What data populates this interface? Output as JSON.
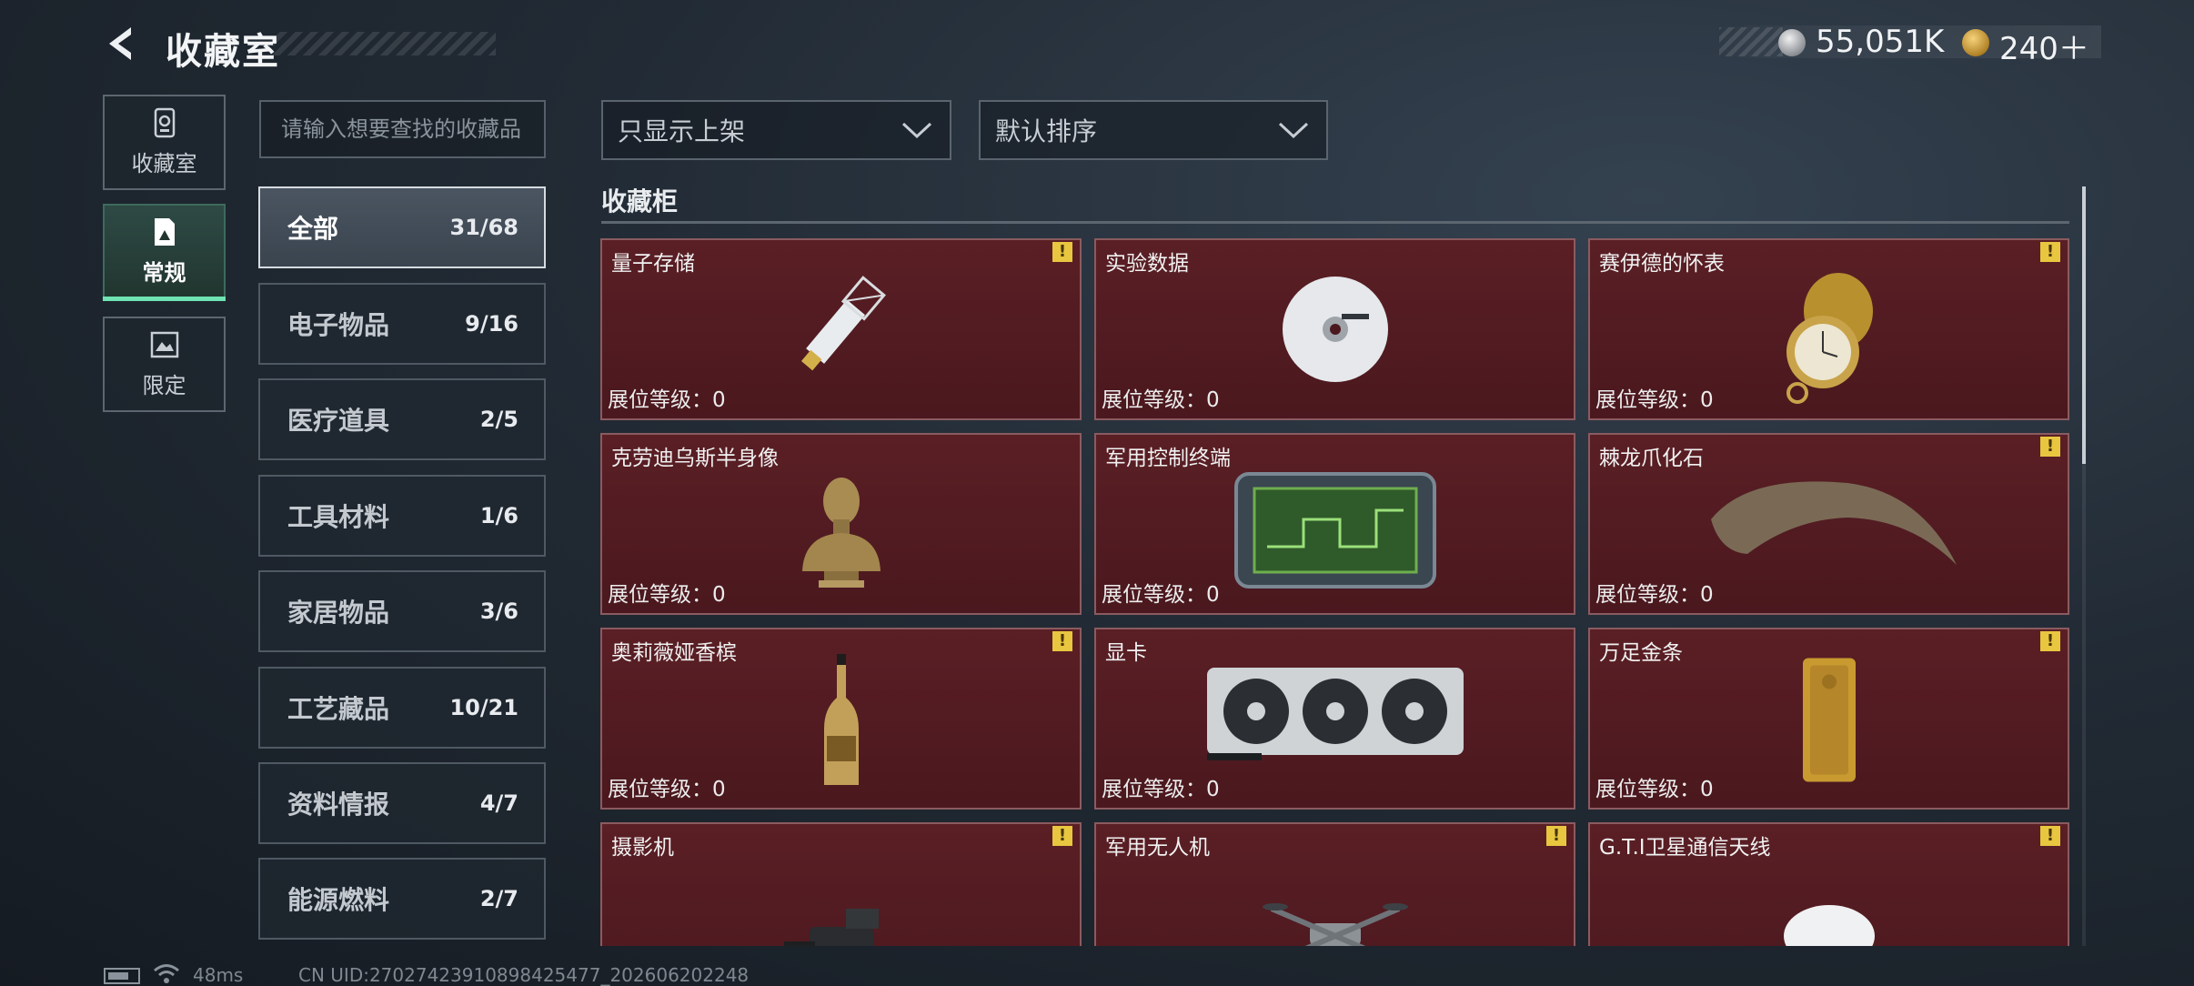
{
  "header": {
    "title": "收藏室",
    "currency1": "55,051K",
    "currency2": "240＋",
    "colors": {
      "currency1_coin": "#8b8f95",
      "currency2_coin": "#b08226"
    }
  },
  "left_nav": [
    {
      "label": "收藏室",
      "icon": "trophy-case-icon"
    },
    {
      "label": "常规",
      "icon": "gallery-icon",
      "selected": true
    },
    {
      "label": "限定",
      "icon": "frame-icon"
    }
  ],
  "search": {
    "placeholder": "请输入想要查找的收藏品"
  },
  "categories": [
    {
      "label": "全部",
      "count": "31/68",
      "active": true
    },
    {
      "label": "电子物品",
      "count": "9/16"
    },
    {
      "label": "医疗道具",
      "count": "2/5"
    },
    {
      "label": "工具材料",
      "count": "1/6"
    },
    {
      "label": "家居物品",
      "count": "3/6"
    },
    {
      "label": "工艺藏品",
      "count": "10/21"
    },
    {
      "label": "资料情报",
      "count": "4/7"
    },
    {
      "label": "能源燃料",
      "count": "2/7"
    }
  ],
  "filters": {
    "filter1": "只显示上架",
    "filter2": "默认排序"
  },
  "section_title": "收藏柜",
  "items": [
    {
      "name": "量子存储",
      "level": "展位等级：0",
      "warn": true,
      "icon": "usb-drive-icon"
    },
    {
      "name": "实验数据",
      "level": "展位等级：0",
      "warn": false,
      "icon": "disc-icon"
    },
    {
      "name": "赛伊德的怀表",
      "level": "展位等级：0",
      "warn": true,
      "icon": "pocket-watch-icon"
    },
    {
      "name": "克劳迪乌斯半身像",
      "level": "展位等级：0",
      "warn": false,
      "icon": "bust-statue-icon"
    },
    {
      "name": "军用控制终端",
      "level": "展位等级：0",
      "warn": false,
      "icon": "tablet-terminal-icon"
    },
    {
      "name": "棘龙爪化石",
      "level": "展位等级：0",
      "warn": true,
      "icon": "claw-fossil-icon"
    },
    {
      "name": "奥莉薇娅香槟",
      "level": "展位等级：0",
      "warn": true,
      "icon": "champagne-bottle-icon"
    },
    {
      "name": "显卡",
      "level": "展位等级：0",
      "warn": false,
      "icon": "graphics-card-icon"
    },
    {
      "name": "万足金条",
      "level": "展位等级：0",
      "warn": true,
      "icon": "gold-bar-icon"
    },
    {
      "name": "摄影机",
      "level": "",
      "warn": true,
      "icon": "video-camera-icon"
    },
    {
      "name": "军用无人机",
      "level": "",
      "warn": true,
      "icon": "drone-icon"
    },
    {
      "name": "G.T.I卫星通信天线",
      "level": "",
      "warn": true,
      "icon": "satellite-dish-icon"
    }
  ],
  "warn_mark": "!",
  "footer": {
    "ping": "48ms",
    "uid": "CN UID:27027423910898425477_202606202248"
  }
}
